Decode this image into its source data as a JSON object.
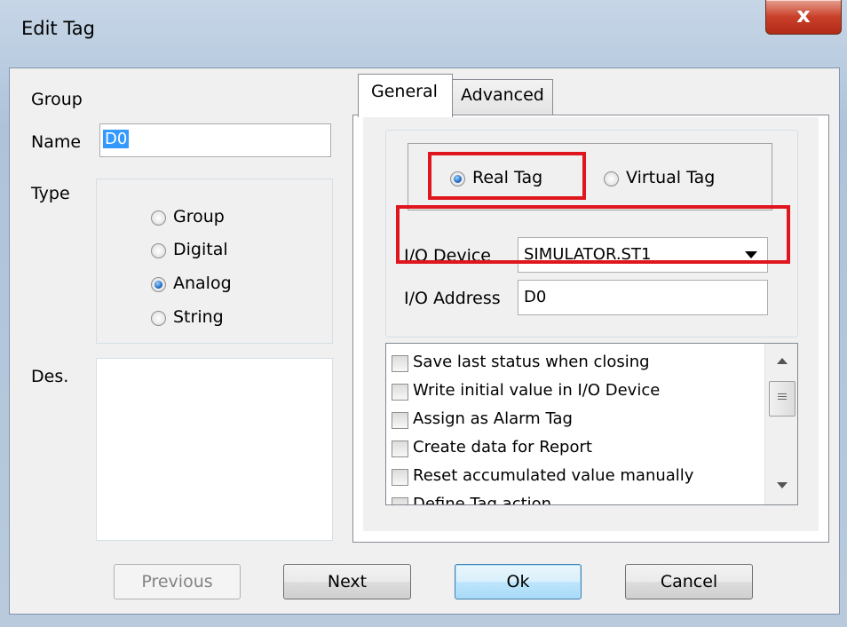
{
  "window": {
    "title": "Edit Tag",
    "close_symbol": "x"
  },
  "left": {
    "group_label": "Group",
    "name_label": "Name",
    "name_value": "D0",
    "type_label": "Type",
    "type_options": [
      {
        "label": "Group",
        "selected": false
      },
      {
        "label": "Digital",
        "selected": false
      },
      {
        "label": "Analog",
        "selected": true
      },
      {
        "label": "String",
        "selected": false
      }
    ],
    "des_label": "Des.",
    "des_value": ""
  },
  "tabs": [
    {
      "label": "General",
      "active": true
    },
    {
      "label": "Advanced",
      "active": false
    }
  ],
  "general": {
    "real_tag_label": "Real Tag",
    "real_tag_selected": true,
    "virtual_tag_label": "Virtual Tag",
    "virtual_tag_selected": false,
    "io_device_label": "I/O Device",
    "io_device_value": "SIMULATOR.ST1",
    "io_address_label": "I/O Address",
    "io_address_value": "D0",
    "options": [
      {
        "label": "Save last status when closing",
        "checked": false
      },
      {
        "label": "Write initial value in I/O Device",
        "checked": false
      },
      {
        "label": "Assign as Alarm Tag",
        "checked": false
      },
      {
        "label": "Create data for Report",
        "checked": false
      },
      {
        "label": "Reset accumulated value manually",
        "checked": false
      },
      {
        "label": "Define Tag action",
        "checked": false
      }
    ]
  },
  "buttons": {
    "previous": "Previous",
    "next": "Next",
    "ok": "Ok",
    "cancel": "Cancel"
  },
  "colors": {
    "highlight": "#e0161e",
    "title_bar": "#b9cadc",
    "close_button": "#c9402a"
  }
}
